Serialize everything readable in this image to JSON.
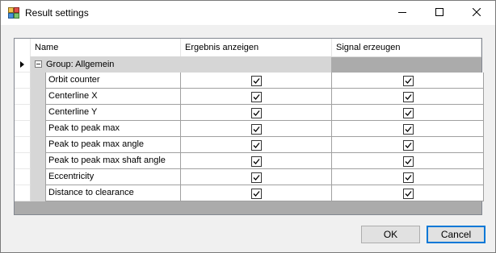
{
  "window": {
    "title": "Result settings",
    "icons": {
      "app": "settings-window-icon",
      "minimize": "minimize-icon",
      "maximize": "maximize-icon",
      "close": "close-icon"
    }
  },
  "grid": {
    "columns": [
      "Name",
      "Ergebnis anzeigen",
      "Signal erzeugen"
    ],
    "group": "Group: Allgemein",
    "rows": [
      {
        "name": "Orbit counter",
        "show_result": true,
        "create_signal": true
      },
      {
        "name": "Centerline X",
        "show_result": true,
        "create_signal": true
      },
      {
        "name": "Centerline Y",
        "show_result": true,
        "create_signal": true
      },
      {
        "name": "Peak to peak max",
        "show_result": true,
        "create_signal": true
      },
      {
        "name": "Peak to peak max angle",
        "show_result": true,
        "create_signal": true
      },
      {
        "name": "Peak to peak max shaft angle",
        "show_result": true,
        "create_signal": true
      },
      {
        "name": "Eccentricity",
        "show_result": true,
        "create_signal": true
      },
      {
        "name": "Distance to clearance",
        "show_result": true,
        "create_signal": true
      }
    ]
  },
  "buttons": {
    "ok": "OK",
    "cancel": "Cancel"
  },
  "colors": {
    "accent": "#0078d7",
    "group_band": "#d6d6d6",
    "grid_background": "#ababab"
  }
}
